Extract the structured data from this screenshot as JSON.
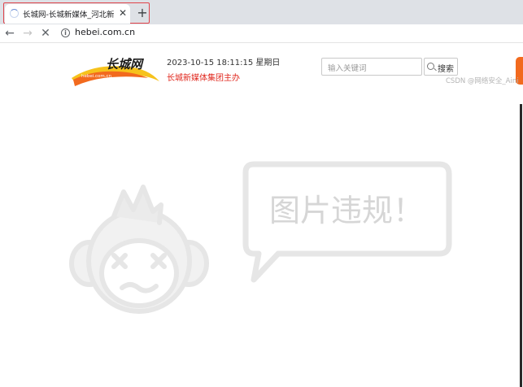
{
  "browser": {
    "tab": {
      "title": "长城网-长城新媒体_河北新闻网",
      "close_icon": "close-icon",
      "loading_icon": "loading-spinner-icon"
    },
    "new_tab_label": "+",
    "toolbar": {
      "back_icon": "arrow-left-icon",
      "forward_icon": "arrow-right-icon",
      "stop_icon": "close-icon",
      "info_icon": "info-icon",
      "address": "hebei.com.cn"
    }
  },
  "page": {
    "logo": {
      "name": "长城网",
      "domain": "hebei.com.cn"
    },
    "datetime": "2023-10-15 18:11:15 星期日",
    "slogan": "长城新媒体集团主办",
    "search": {
      "placeholder": "输入关键词",
      "button_label": "搜索"
    },
    "watermark": "CSDN @网络安全_Aini",
    "violation_message": "图片违规！",
    "colors": {
      "accent_red": "#e0261c",
      "logo_orange": "#f26a1e",
      "logo_yellow": "#f6c21c",
      "placeholder_gray": "#e6e6e6"
    }
  }
}
